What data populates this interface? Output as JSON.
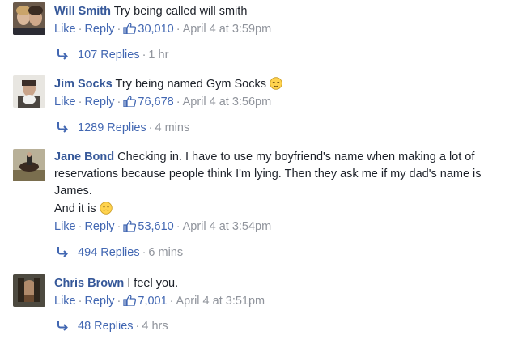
{
  "comments": [
    {
      "name": "Will Smith",
      "text": "Try being called will smith",
      "like_label": "Like",
      "reply_label": "Reply",
      "likes": "30,010",
      "timestamp": "April 4 at 3:59pm",
      "replies": "107 Replies",
      "replies_time": "1 hr"
    },
    {
      "name": "Jim Socks",
      "text": "Try being named Gym Socks",
      "emoji": "relieved-emoji",
      "like_label": "Like",
      "reply_label": "Reply",
      "likes": "76,678",
      "timestamp": "April 4 at 3:56pm",
      "replies": "1289 Replies",
      "replies_time": "4 mins"
    },
    {
      "name": "Jane Bond",
      "text": "Checking in. I have to use my boyfriend's name when making a lot of reservations because people think I'm lying. Then they ask me if my dad's name is James.",
      "text2": "And it is",
      "emoji": "sad-emoji",
      "like_label": "Like",
      "reply_label": "Reply",
      "likes": "53,610",
      "timestamp": "April 4 at 3:54pm",
      "replies": "494 Replies",
      "replies_time": "6 mins"
    },
    {
      "name": "Chris Brown",
      "text": "I feel you.",
      "like_label": "Like",
      "reply_label": "Reply",
      "likes": "7,001",
      "timestamp": "April 4 at 3:51pm",
      "replies": "48 Replies",
      "replies_time": "4 hrs"
    }
  ],
  "colors": {
    "name": "#365899",
    "link": "#4267b2",
    "meta": "#90949c"
  }
}
